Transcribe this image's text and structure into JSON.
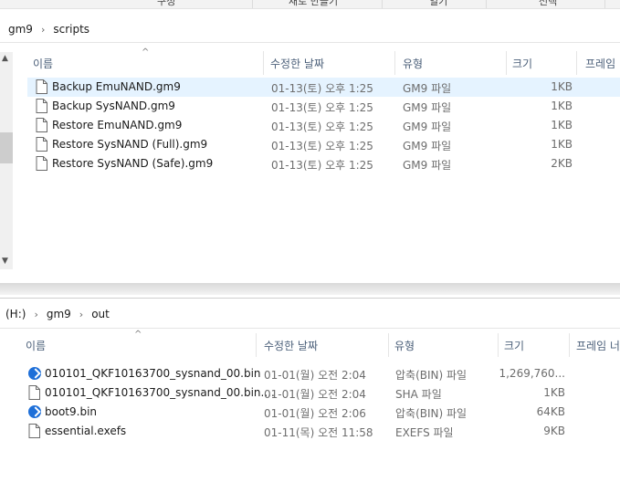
{
  "ribbon": {
    "items": [
      "구성",
      "새로 만들기",
      "열기",
      "선택"
    ]
  },
  "window1": {
    "breadcrumb": [
      "gm9",
      "scripts"
    ],
    "columns": {
      "name": "이름",
      "date": "수정한 날짜",
      "type": "유형",
      "size": "크기",
      "frame": "프레임"
    },
    "files": [
      {
        "name": "Backup EmuNAND.gm9",
        "date": "01-13(토) 오후 1:25",
        "type": "GM9 파일",
        "size": "1KB",
        "icon": "file-icon",
        "selected": true
      },
      {
        "name": "Backup SysNAND.gm9",
        "date": "01-13(토) 오후 1:25",
        "type": "GM9 파일",
        "size": "1KB",
        "icon": "file-icon"
      },
      {
        "name": "Restore EmuNAND.gm9",
        "date": "01-13(토) 오후 1:25",
        "type": "GM9 파일",
        "size": "1KB",
        "icon": "file-icon"
      },
      {
        "name": "Restore SysNAND (Full).gm9",
        "date": "01-13(토) 오후 1:25",
        "type": "GM9 파일",
        "size": "1KB",
        "icon": "file-icon"
      },
      {
        "name": "Restore SysNAND (Safe).gm9",
        "date": "01-13(토) 오후 1:25",
        "type": "GM9 파일",
        "size": "2KB",
        "icon": "file-icon"
      }
    ]
  },
  "window2": {
    "breadcrumb": [
      "(H:)",
      "gm9",
      "out"
    ],
    "columns": {
      "name": "이름",
      "date": "수정한 날짜",
      "type": "유형",
      "size": "크기",
      "frame": "프레임 너"
    },
    "files": [
      {
        "name": "010101_QKF10163700_sysnand_00.bin",
        "date": "01-01(월) 오전 2:04",
        "type": "압축(BIN) 파일",
        "size": "1,269,760...",
        "icon": "bin-archive-icon"
      },
      {
        "name": "010101_QKF10163700_sysnand_00.bin....",
        "date": "01-01(월) 오전 2:04",
        "type": "SHA 파일",
        "size": "1KB",
        "icon": "file-icon"
      },
      {
        "name": "boot9.bin",
        "date": "01-01(월) 오전 2:06",
        "type": "압축(BIN) 파일",
        "size": "64KB",
        "icon": "bin-archive-icon"
      },
      {
        "name": "essential.exefs",
        "date": "01-11(목) 오전 11:58",
        "type": "EXEFS 파일",
        "size": "9KB",
        "icon": "file-icon"
      }
    ]
  },
  "colors": {
    "selection": "#e5f3ff",
    "header_text": "#4c607a",
    "bin_icon": "#1e6fd8"
  }
}
